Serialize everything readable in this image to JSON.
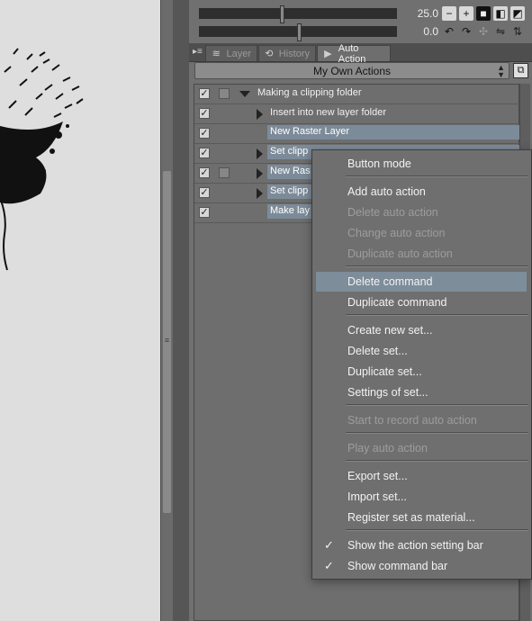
{
  "navigator": {
    "zoom_value": "25.0",
    "rotate_value": "0.0"
  },
  "tabs": [
    {
      "label": "Layer",
      "icon": "layer-icon"
    },
    {
      "label": "History",
      "icon": "history-icon"
    },
    {
      "label": "Auto Action",
      "icon": "auto-action-icon"
    }
  ],
  "set_selector": {
    "value": "My Own Actions"
  },
  "actions": [
    {
      "label": "Making a clipping folder"
    },
    {
      "label": "Insert into new layer folder"
    },
    {
      "label": "New Raster Layer"
    },
    {
      "label": "Set clipp"
    },
    {
      "label": "New Ras"
    },
    {
      "label": "Set clipp"
    },
    {
      "label": "Make lay"
    }
  ],
  "menu": {
    "button_mode": "Button mode",
    "add_auto_action": "Add auto action",
    "delete_auto_action": "Delete auto action",
    "change_auto_action": "Change auto action",
    "duplicate_auto_action": "Duplicate auto action",
    "delete_command": "Delete command",
    "duplicate_command": "Duplicate command",
    "create_new_set": "Create new set...",
    "delete_set": "Delete set...",
    "duplicate_set": "Duplicate set...",
    "settings_of_set": "Settings of set...",
    "start_record": "Start to record auto action",
    "play_auto_action": "Play auto action",
    "export_set": "Export set...",
    "import_set": "Import set...",
    "register_set": "Register set as material...",
    "show_action_setting_bar": "Show the action setting bar",
    "show_command_bar": "Show command bar"
  },
  "colors": {
    "menu_highlight": "#7d8d9a",
    "selected_row": "#7c8b99",
    "panel_bg": "#707070"
  }
}
